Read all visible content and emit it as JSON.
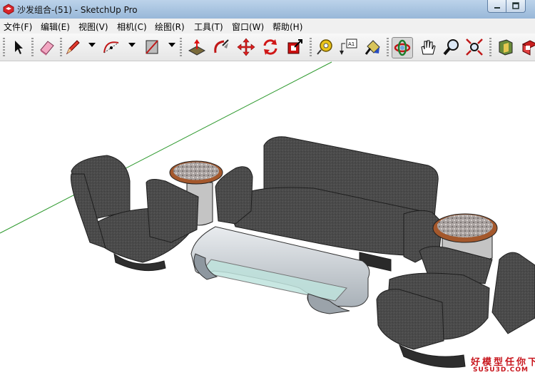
{
  "window": {
    "title": "沙发组合-(51) - SketchUp Pro"
  },
  "menu": [
    {
      "label": "文件(F)"
    },
    {
      "label": "编辑(E)"
    },
    {
      "label": "视图(V)"
    },
    {
      "label": "相机(C)"
    },
    {
      "label": "绘图(R)"
    },
    {
      "label": "工具(T)"
    },
    {
      "label": "窗口(W)"
    },
    {
      "label": "帮助(H)"
    }
  ],
  "toolbar": {
    "tools": [
      "select-icon",
      "eraser-icon",
      "pencil-icon",
      "arc-icon",
      "rectangle-icon",
      "push-pull-icon",
      "follow-me-icon",
      "move-icon",
      "rotate-icon",
      "scale-icon",
      "tape-measure-icon",
      "text-label-icon",
      "paint-bucket-icon",
      "orbit-icon",
      "pan-icon",
      "zoom-icon",
      "zoom-extents-icon",
      "components-icon",
      "materials-icon"
    ],
    "active_tool": "orbit-icon"
  },
  "viewport": {
    "background": "#ffffff",
    "green_axis": "#2f9a2f"
  },
  "watermark": {
    "main": "好模型任你下",
    "sub": "SUSU3D.COM"
  }
}
